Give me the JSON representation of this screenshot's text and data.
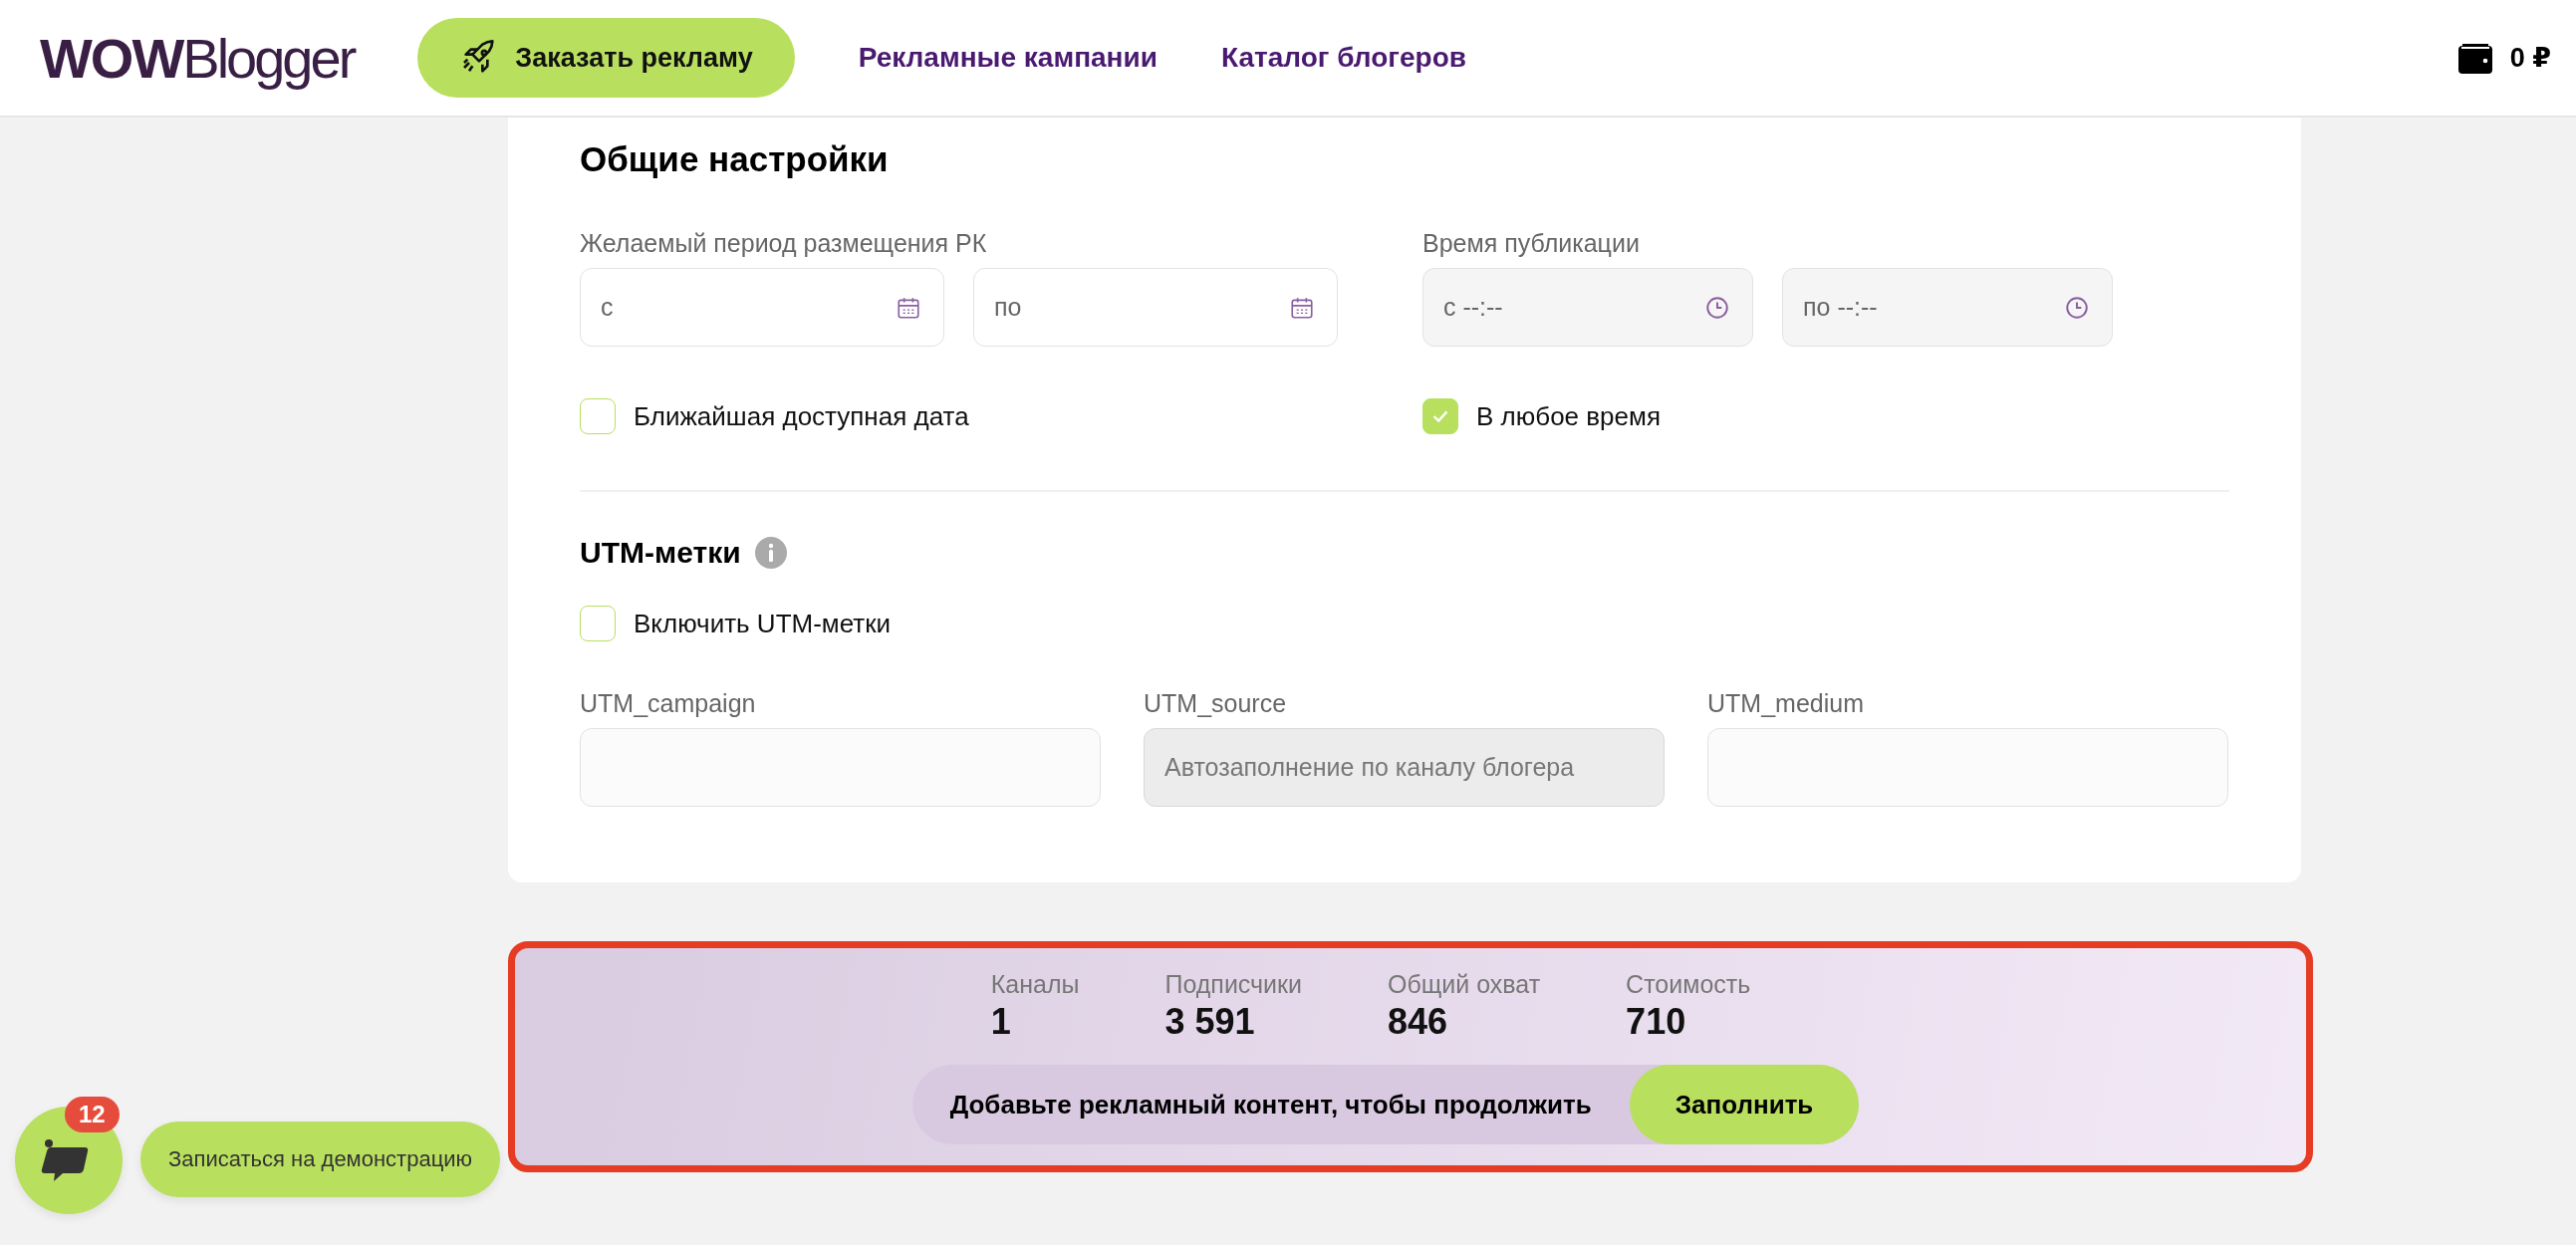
{
  "header": {
    "logo": {
      "bold": "WOW",
      "light": "Blogger"
    },
    "order_button": "Заказать рекламу",
    "nav": [
      {
        "label": "Рекламные кампании",
        "selected": false
      },
      {
        "label": "Каталог блогеров",
        "selected": false
      }
    ],
    "balance": "0 ₽"
  },
  "general_settings": {
    "title": "Общие настройки",
    "period": {
      "label": "Желаемый период размещения РК",
      "fields": [
        {
          "placeholder": "с"
        },
        {
          "placeholder": "по"
        }
      ]
    },
    "time": {
      "label": "Время публикации",
      "fields": [
        {
          "placeholder": "с --:--",
          "disabled": true
        },
        {
          "placeholder": "по --:--",
          "disabled": true
        }
      ]
    },
    "options": [
      {
        "label": "Ближайшая доступная дата",
        "checked": false
      },
      {
        "label": "В любое время",
        "checked": true
      }
    ]
  },
  "utm": {
    "title": "UTM-метки",
    "enable": {
      "label": "Включить UTM-метки",
      "checked": false
    },
    "fields": [
      {
        "label": "UTM_campaign",
        "disabled": false
      },
      {
        "label": "UTM_source",
        "placeholder": "Автозаполнение по каналу блогера",
        "disabled": true
      },
      {
        "label": "UTM_medium",
        "disabled": false
      }
    ]
  },
  "summary": {
    "stats": [
      {
        "label": "Каналы",
        "value": "1"
      },
      {
        "label": "Подписчики",
        "value": "3 591"
      },
      {
        "label": "Общий охват",
        "value": "846"
      },
      {
        "label": "Стоимость",
        "value": "710"
      }
    ],
    "message": "Добавьте рекламный контент, чтобы продолжить",
    "fill_button": "Заполнить"
  },
  "chat": {
    "badge": "12",
    "demo_button": "Записаться на демонстрацию"
  }
}
